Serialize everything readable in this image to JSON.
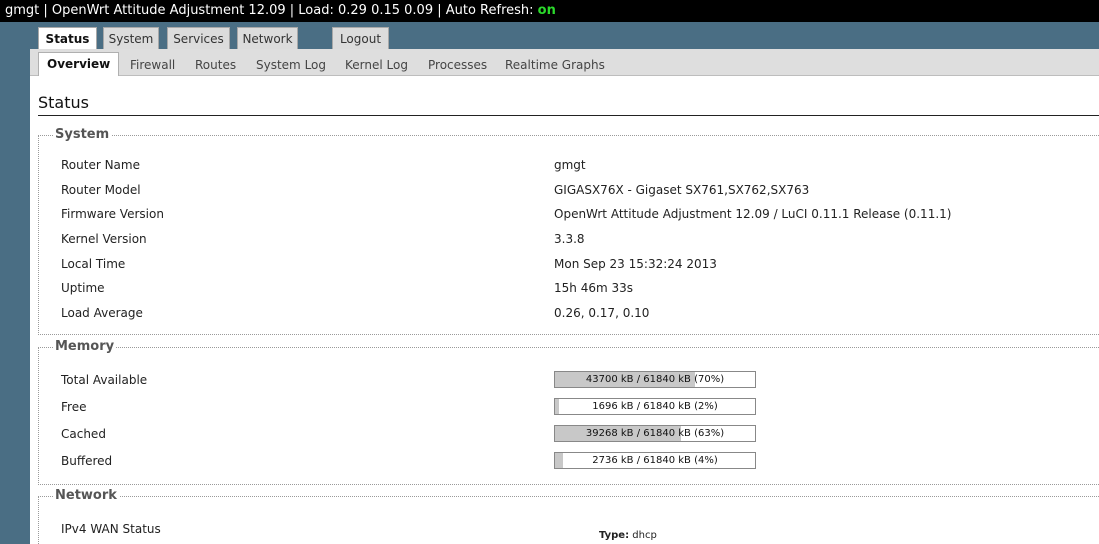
{
  "topbar": {
    "text": "gmgt | OpenWrt Attitude Adjustment 12.09 | Load: 0.29 0.15 0.09 | Auto Refresh: ",
    "refresh_state": "on"
  },
  "main_tabs": [
    "Status",
    "System",
    "Services",
    "Network",
    "Logout"
  ],
  "sub_tabs": [
    "Overview",
    "Firewall",
    "Routes",
    "System Log",
    "Kernel Log",
    "Processes",
    "Realtime Graphs"
  ],
  "page_title": "Status",
  "system": {
    "legend": "System",
    "rows": [
      {
        "label": "Router Name",
        "value": "gmgt"
      },
      {
        "label": "Router Model",
        "value": "GIGASX76X - Gigaset SX761,SX762,SX763"
      },
      {
        "label": "Firmware Version",
        "value": "OpenWrt Attitude Adjustment 12.09 / LuCI 0.11.1 Release (0.11.1)"
      },
      {
        "label": "Kernel Version",
        "value": "3.3.8"
      },
      {
        "label": "Local Time",
        "value": "Mon Sep 23 15:32:24 2013"
      },
      {
        "label": "Uptime",
        "value": "15h 46m 33s"
      },
      {
        "label": "Load Average",
        "value": "0.26, 0.17, 0.10"
      }
    ]
  },
  "memory": {
    "legend": "Memory",
    "rows": [
      {
        "label": "Total Available",
        "text": "43700 kB / 61840 kB (70%)",
        "percent": 70
      },
      {
        "label": "Free",
        "text": "1696 kB / 61840 kB (2%)",
        "percent": 2
      },
      {
        "label": "Cached",
        "text": "39268 kB / 61840 kB (63%)",
        "percent": 63
      },
      {
        "label": "Buffered",
        "text": "2736 kB / 61840 kB (4%)",
        "percent": 4
      }
    ]
  },
  "network": {
    "legend": "Network",
    "wan_label": "IPv4 WAN Status",
    "type_label": "Type:",
    "type_value": "dhcp"
  }
}
